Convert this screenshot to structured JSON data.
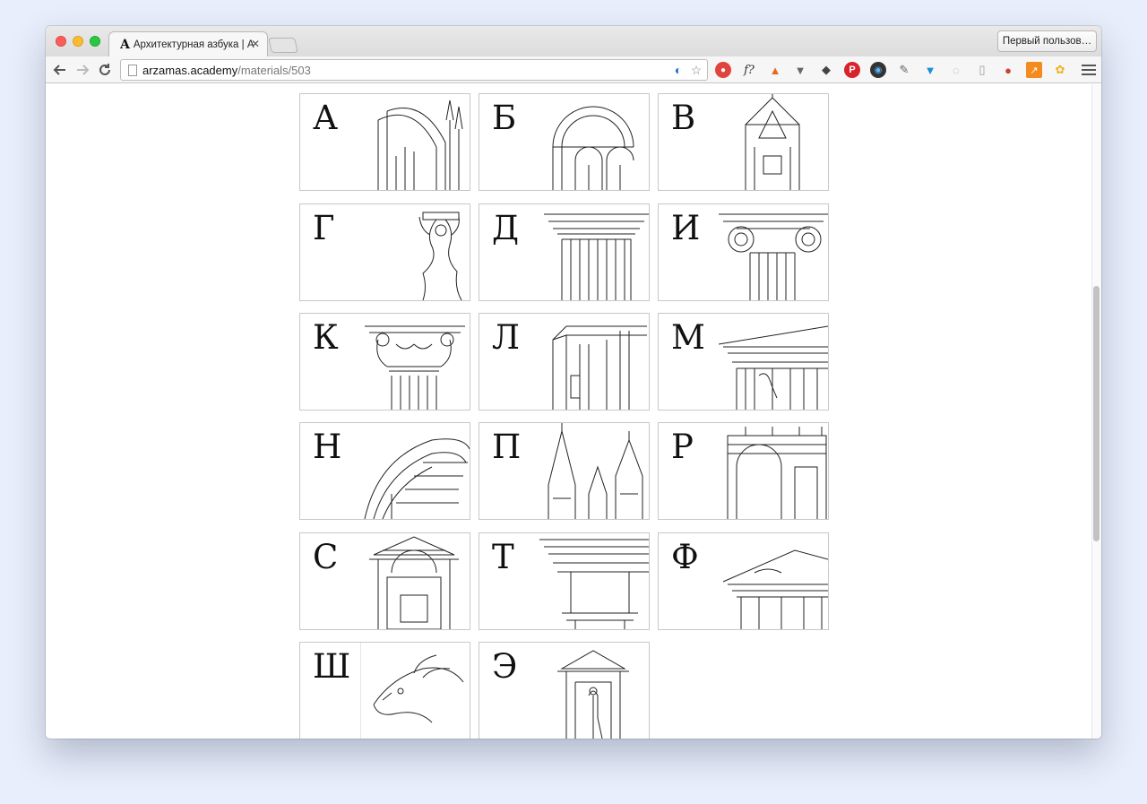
{
  "browser": {
    "tab_title": "Архитектурная азбука | Ар",
    "tab_favicon": "A",
    "profile_button": "Первый пользов…",
    "url_host": "arzamas.academy",
    "url_path": "/materials/503",
    "icons": [
      "back-icon",
      "forward-icon",
      "reload-icon",
      "page-icon",
      "extension-icon",
      "star-icon",
      "menu-icon"
    ]
  },
  "alphabet": {
    "letters": [
      "А",
      "Б",
      "В",
      "Г",
      "Д",
      "И",
      "К",
      "Л",
      "М",
      "Н",
      "П",
      "Р",
      "С",
      "Т",
      "Ф",
      "Ш",
      "Э"
    ]
  },
  "colors": {
    "page_background": "#e8eefb",
    "card_border": "#c8c8c8"
  }
}
